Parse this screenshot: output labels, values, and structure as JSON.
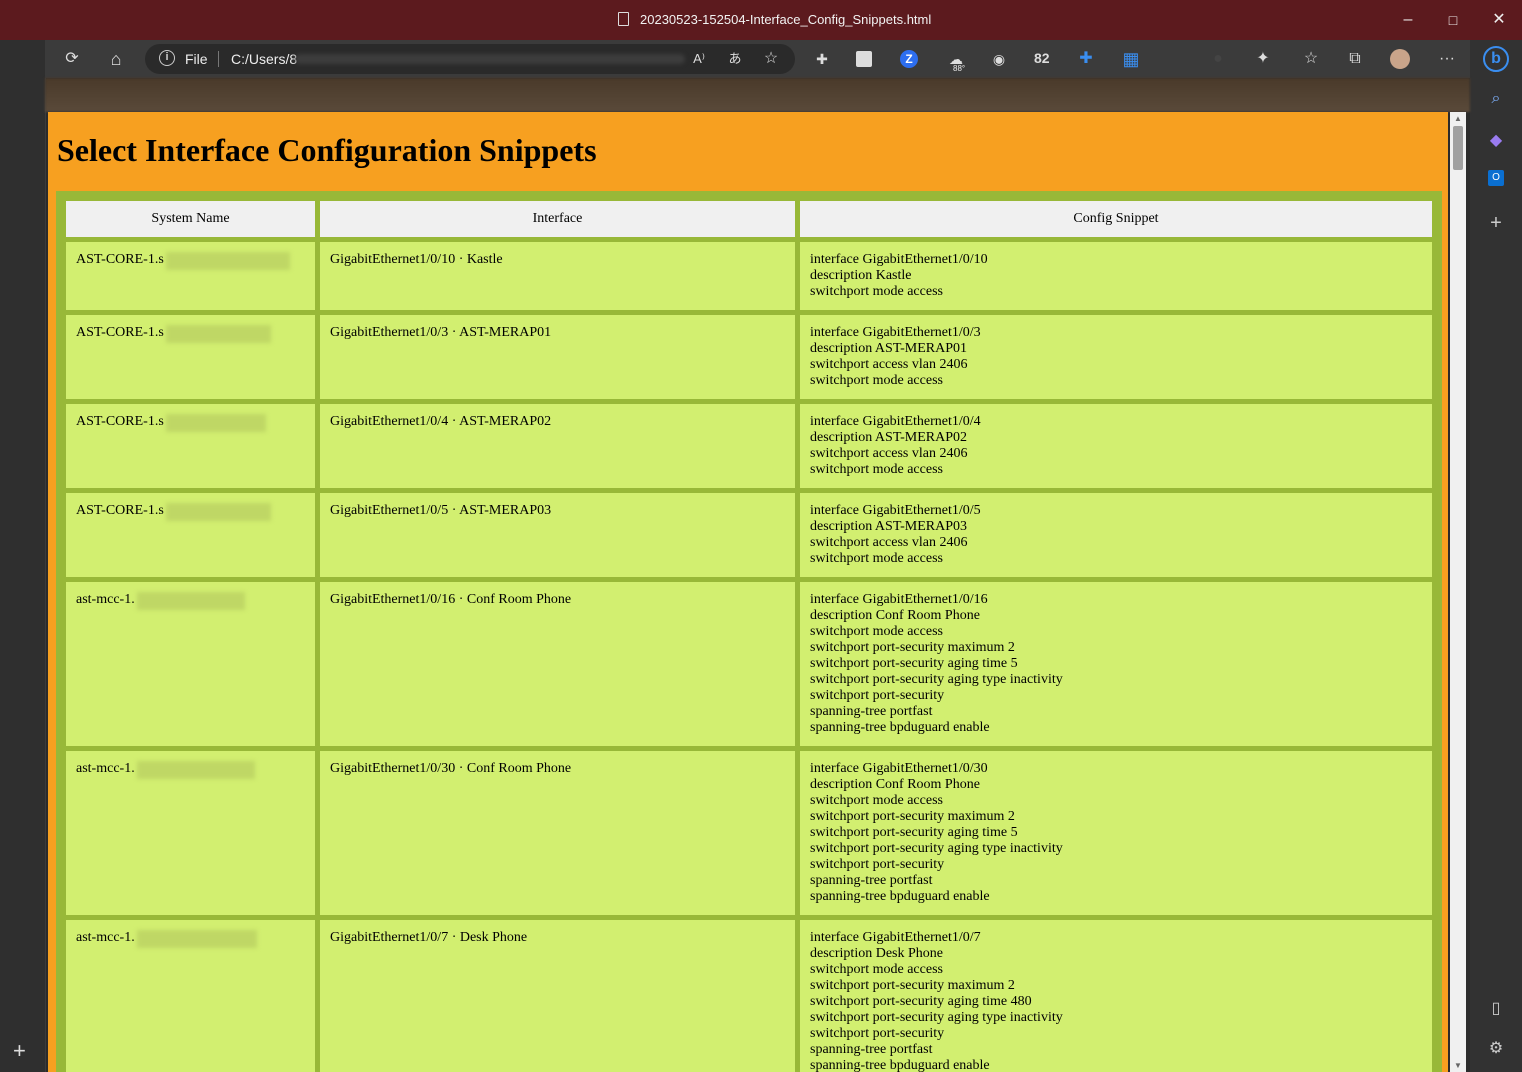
{
  "window": {
    "title": "20230523-152504-Interface_Config_Snippets.html",
    "controls": {
      "minimize": "–",
      "maximize": "□",
      "close": "✕"
    }
  },
  "toolbar": {
    "address_prefix": "File",
    "address_url": "C:/Users/8",
    "weather_temp": "88°",
    "extension_count": "82"
  },
  "page": {
    "heading": "Select Interface Configuration Snippets",
    "columns": [
      "System Name",
      "Interface",
      "Config Snippet"
    ],
    "rows": [
      {
        "system": "AST-CORE-1.s",
        "interface": "GigabitEthernet1/0/10 · Kastle",
        "snippet": [
          "interface GigabitEthernet1/0/10",
          "description Kastle",
          "switchport mode access"
        ]
      },
      {
        "system": "AST-CORE-1.s",
        "interface": "GigabitEthernet1/0/3 · AST-MERAP01",
        "snippet": [
          "interface GigabitEthernet1/0/3",
          "description AST-MERAP01",
          "switchport access vlan 2406",
          "switchport mode access"
        ]
      },
      {
        "system": "AST-CORE-1.s",
        "interface": "GigabitEthernet1/0/4 · AST-MERAP02",
        "snippet": [
          "interface GigabitEthernet1/0/4",
          "description AST-MERAP02",
          "switchport access vlan 2406",
          "switchport mode access"
        ]
      },
      {
        "system": "AST-CORE-1.s",
        "interface": "GigabitEthernet1/0/5 · AST-MERAP03",
        "snippet": [
          "interface GigabitEthernet1/0/5",
          "description AST-MERAP03",
          "switchport access vlan 2406",
          "switchport mode access"
        ]
      },
      {
        "system": "ast-mcc-1.",
        "interface": "GigabitEthernet1/0/16 · Conf Room Phone",
        "snippet": [
          "interface GigabitEthernet1/0/16",
          "description Conf Room Phone",
          "switchport mode access",
          "switchport port-security maximum 2",
          "switchport port-security aging time 5",
          "switchport port-security aging type inactivity",
          "switchport port-security",
          "spanning-tree portfast",
          "spanning-tree bpduguard enable"
        ]
      },
      {
        "system": "ast-mcc-1.",
        "interface": "GigabitEthernet1/0/30 · Conf Room Phone",
        "snippet": [
          "interface GigabitEthernet1/0/30",
          "description Conf Room Phone",
          "switchport mode access",
          "switchport port-security maximum 2",
          "switchport port-security aging time 5",
          "switchport port-security aging type inactivity",
          "switchport port-security",
          "spanning-tree portfast",
          "spanning-tree bpduguard enable"
        ]
      },
      {
        "system": "ast-mcc-1.",
        "interface": "GigabitEthernet1/0/7 · Desk Phone",
        "snippet": [
          "interface GigabitEthernet1/0/7",
          "description Desk Phone",
          "switchport mode access",
          "switchport port-security maximum 2",
          "switchport port-security aging time 480",
          "switchport port-security aging type inactivity",
          "switchport port-security",
          "spanning-tree portfast",
          "spanning-tree bpduguard enable"
        ]
      }
    ]
  },
  "icons": {
    "refresh": "⟳",
    "home": "⌂",
    "read_aloud": "A⁾",
    "translate": "あ",
    "add_favorite": "☆",
    "extensions": "✦",
    "favorites": "☆",
    "collections": "⧉",
    "more": "···",
    "search": "⌕",
    "add": "+",
    "settings": "⚙",
    "sidebar": "▯"
  },
  "colors": {
    "titlebar": "#5c1a1e",
    "page_background": "#f7a020",
    "table_border": "#98b838",
    "cell_background": "#d2ef70",
    "header_cell": "#f0f0f0"
  }
}
